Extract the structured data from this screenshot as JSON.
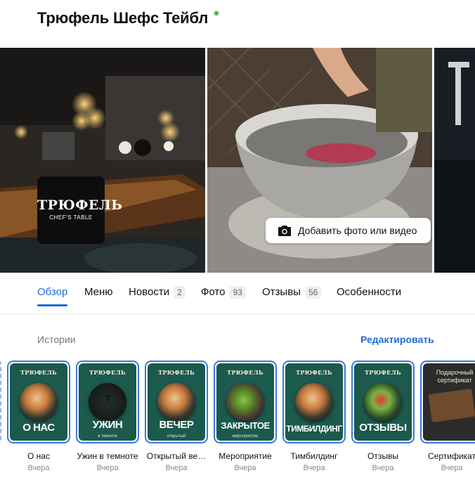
{
  "header": {
    "title": "Трюфель Шефс Тейбл"
  },
  "gallery": {
    "logo": {
      "main": "ТРЮФЕЛЬ",
      "sub": "CHEF'S TABLE"
    },
    "add_media_label": "Добавить фото или видео"
  },
  "tabs": [
    {
      "label": "Обзор",
      "count": "",
      "active": true
    },
    {
      "label": "Меню",
      "count": ""
    },
    {
      "label": "Новости",
      "count": "2"
    },
    {
      "label": "Фото",
      "count": "93"
    },
    {
      "label": "Отзывы",
      "count": "56"
    },
    {
      "label": "Особенности",
      "count": ""
    }
  ],
  "stories": {
    "heading": "Истории",
    "edit_label": "Редактировать",
    "items": [
      {
        "brand": "ТРЮФЕЛЬ",
        "caption": "О НАС",
        "subcaption": "",
        "name": "О нас",
        "date": "Вчера"
      },
      {
        "brand": "ТРЮФЕЛЬ",
        "caption": "УЖИН",
        "subcaption": "в темноте",
        "name": "Ужин в темноте",
        "date": "Вчера"
      },
      {
        "brand": "ТРЮФЕЛЬ",
        "caption": "ВЕЧЕР",
        "subcaption": "открытый",
        "name": "Открытый ве…",
        "date": "Вчера"
      },
      {
        "brand": "ТРЮФЕЛЬ",
        "caption": "ЗАКРЫТОЕ",
        "subcaption": "мероприятие",
        "name": "Мероприятие",
        "date": "Вчера"
      },
      {
        "brand": "ТРЮФЕЛЬ",
        "caption": "ТИМБИЛДИНГ",
        "subcaption": "",
        "name": "Тимбилдинг",
        "date": "Вчера"
      },
      {
        "brand": "ТРЮФЕЛЬ",
        "caption": "ОТЗЫВЫ",
        "subcaption": "",
        "name": "Отзывы",
        "date": "Вчера"
      },
      {
        "cert_title": "Подарочный сертификат",
        "name": "Сертификат",
        "date": "Вчера"
      }
    ]
  },
  "colors": {
    "accent": "#1f6bd6",
    "story_card": "#1b5a4c",
    "verified": "#4caf50"
  }
}
